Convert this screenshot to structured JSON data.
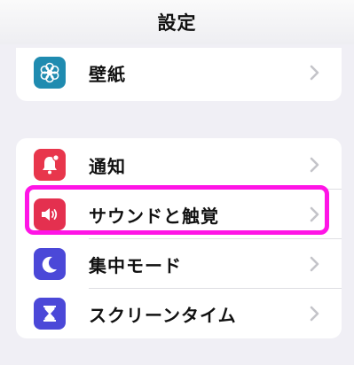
{
  "nav": {
    "title": "設定"
  },
  "rows": {
    "wallpaper": {
      "label": "壁紙",
      "icon": "flower-icon",
      "color": "#1f8bb0"
    },
    "notifications": {
      "label": "通知",
      "icon": "bell-icon",
      "color": "#e8364c"
    },
    "sounds": {
      "label": "サウンドと触覚",
      "icon": "speaker-icon",
      "color": "#e4304f"
    },
    "focus": {
      "label": "集中モード",
      "icon": "moon-icon",
      "color": "#4b48d8"
    },
    "screentime": {
      "label": "スクリーンタイム",
      "icon": "hourglass-icon",
      "color": "#4b48d8"
    }
  },
  "highlight_color": "#ff14e6"
}
